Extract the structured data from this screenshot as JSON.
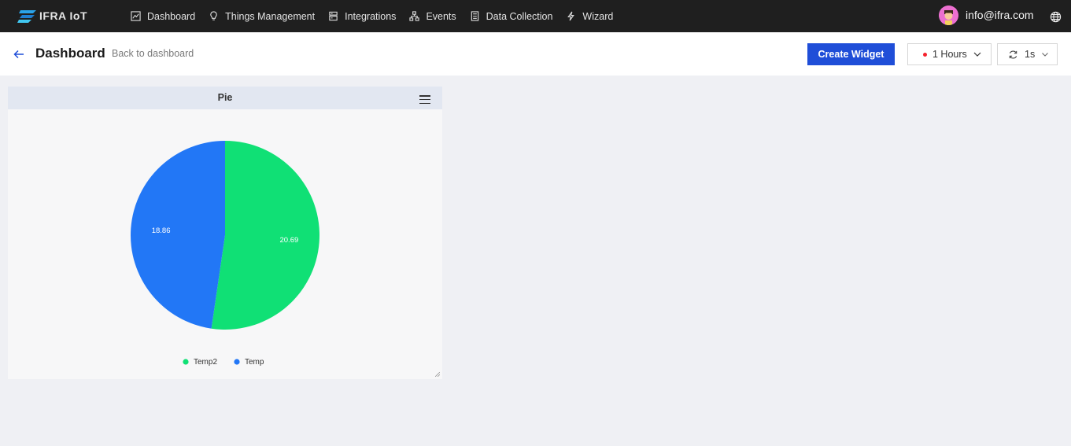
{
  "app": {
    "name": "IFRA IoT"
  },
  "nav": {
    "items": [
      {
        "label": "Dashboard",
        "icon": "chart-line-icon"
      },
      {
        "label": "Things Management",
        "icon": "lightbulb-icon"
      },
      {
        "label": "Integrations",
        "icon": "server-icon"
      },
      {
        "label": "Events",
        "icon": "network-icon"
      },
      {
        "label": "Data Collection",
        "icon": "document-icon"
      },
      {
        "label": "Wizard",
        "icon": "bolt-icon"
      }
    ]
  },
  "user": {
    "email": "info@ifra.com"
  },
  "header": {
    "title": "Dashboard",
    "back_label": "Back to dashboard",
    "create_label": "Create Widget",
    "time_range": "1 Hours",
    "refresh_interval": "1s"
  },
  "widget": {
    "title": "Pie"
  },
  "chart_data": {
    "type": "pie",
    "title": "Pie",
    "slices": [
      {
        "name": "Temp2",
        "value": 20.69,
        "color": "#10e075"
      },
      {
        "name": "Temp",
        "value": 18.86,
        "color": "#2277f6"
      }
    ],
    "legend_position": "bottom"
  },
  "colors": {
    "accent": "#1f4ed8",
    "topbar": "#1f1f1f",
    "status_dot": "#f5222d"
  }
}
